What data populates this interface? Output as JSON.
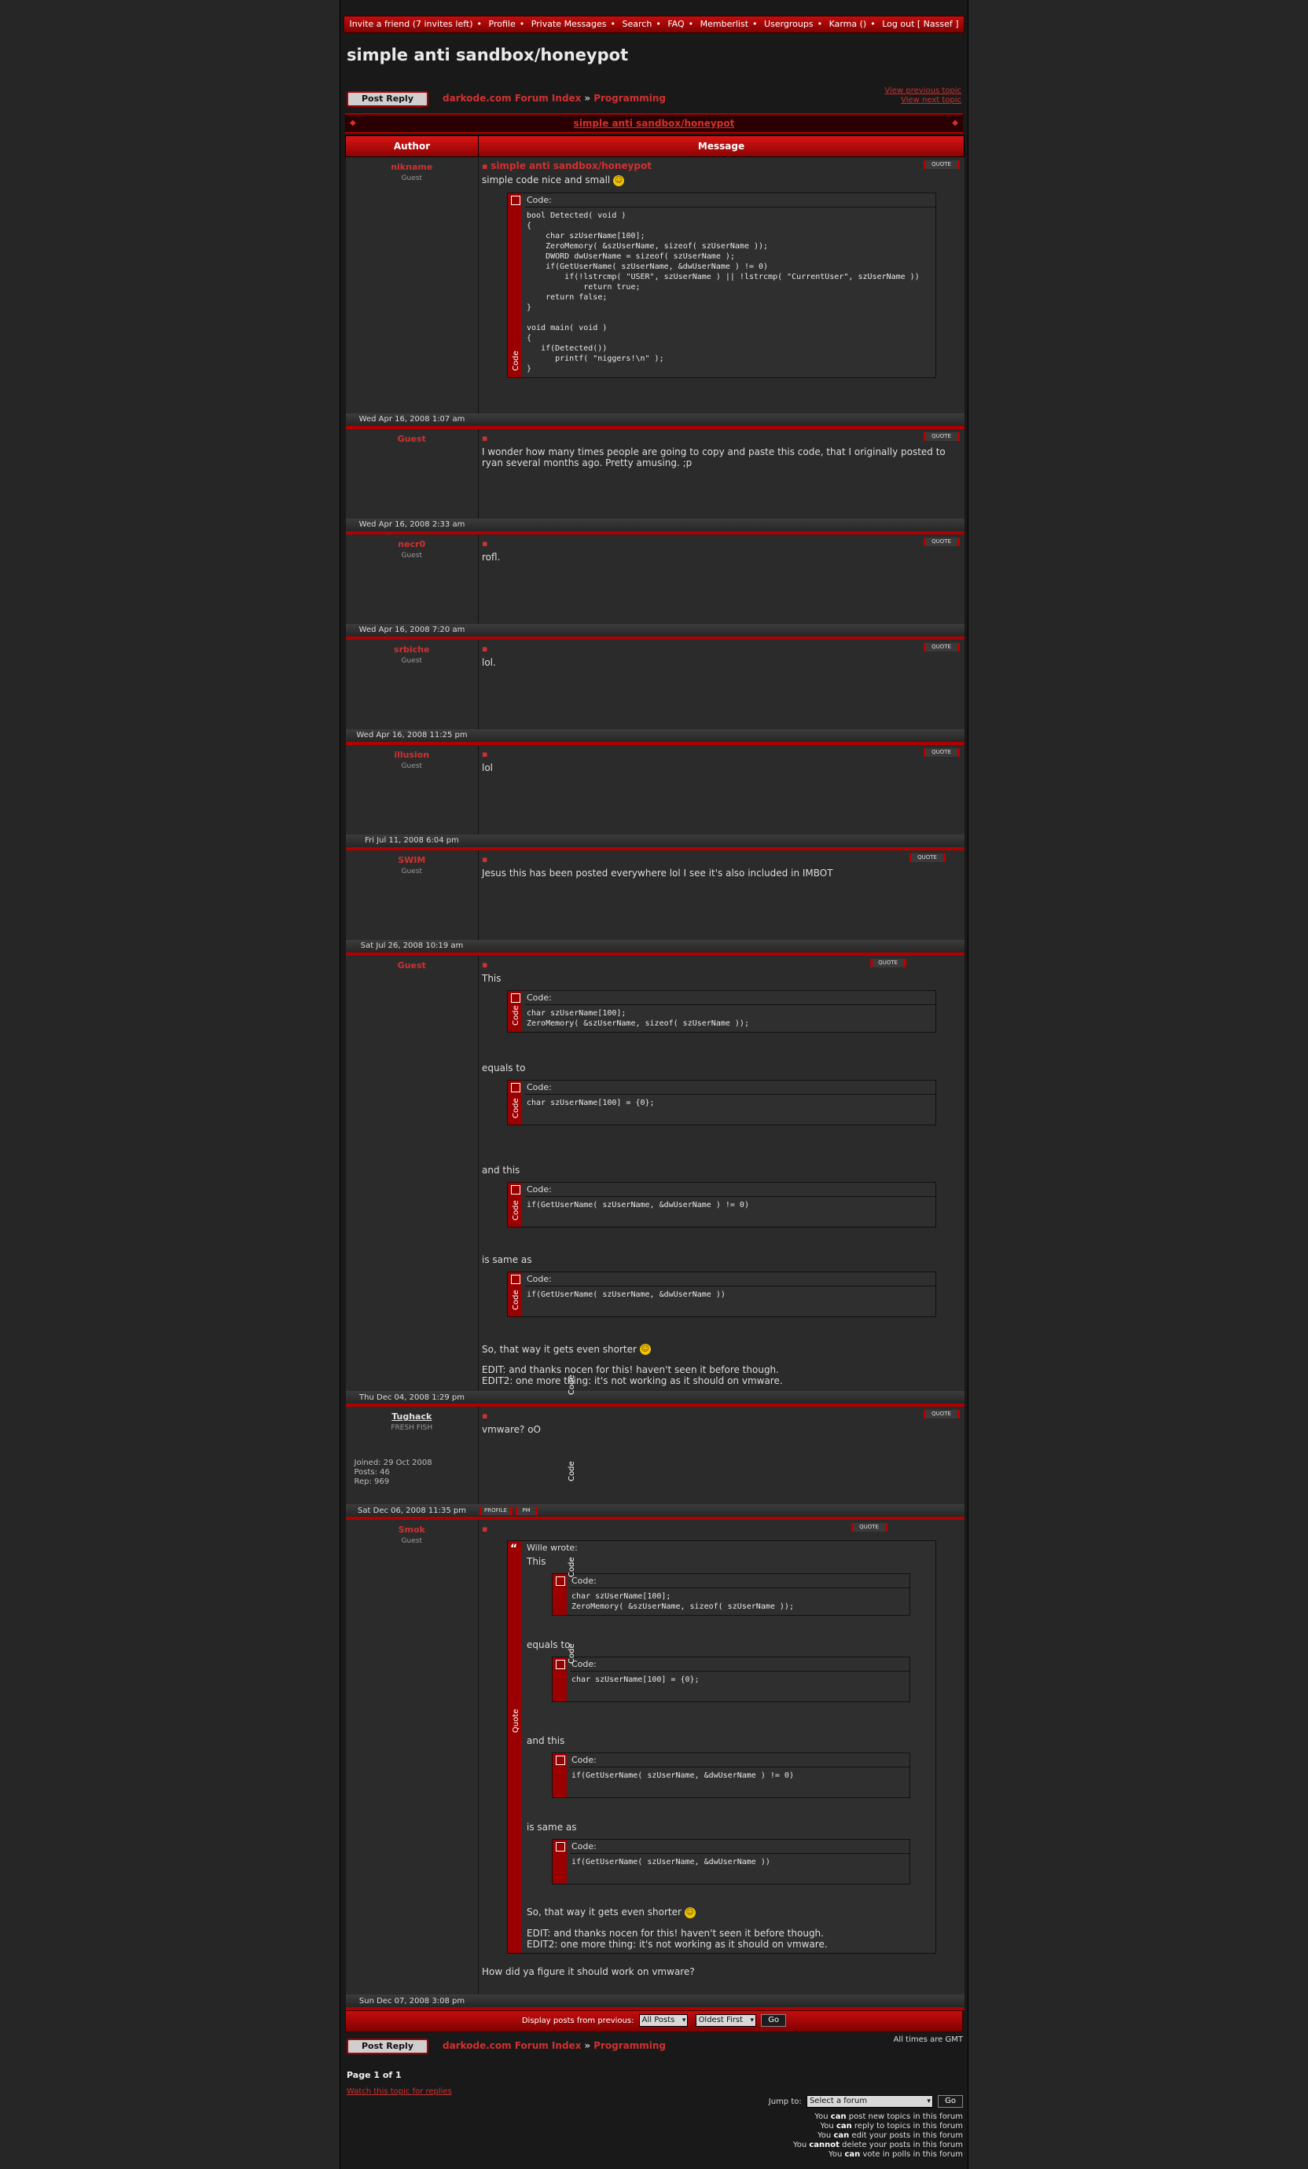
{
  "nav": {
    "items": [
      "Invite a friend (7 invites left)",
      "Profile",
      "Private Messages",
      "Search",
      "FAQ",
      "Memberlist",
      "Usergroups",
      "Karma ()",
      "Log out [ Nassef ]"
    ],
    "separator": "•"
  },
  "page_title": "simple anti sandbox/honeypot",
  "actions": {
    "post_reply": "Post Reply",
    "forum_index": "darkode.com Forum Index",
    "crumb_sep": "»",
    "forum": "Programming",
    "prev_topic": "View previous topic",
    "next_topic": "View next topic"
  },
  "topic_link": "simple anti sandbox/honeypot",
  "table": {
    "author_header": "Author",
    "message_header": "Message"
  },
  "posts": [
    {
      "author": "nikname",
      "rank": "Guest",
      "date": "Wed Apr 16, 2008 1:07 am",
      "title": "simple anti sandbox/honeypot",
      "text_before": "simple code nice and small",
      "smiley_after_text": true,
      "code": "bool Detected( void )\n{\n    char szUserName[100];\n    ZeroMemory( &szUserName, sizeof( szUserName ));\n    DWORD dwUserName = sizeof( szUserName );\n    if(GetUserName( szUserName, &dwUserName ) != 0)\n        if(!lstrcmp( \"USER\", szUserName ) || !lstrcmp( \"CurrentUser\", szUserName ))\n            return true;\n    return false;\n}\n\nvoid main( void )\n{\n   if(Detected())\n      printf( \"niggers!\\n\" );\n}"
    },
    {
      "author": "Guest",
      "rank": "",
      "date": "Wed Apr 16, 2008 2:33 am",
      "text": "I wonder how many times people are going to copy and paste this code, that I originally posted to ryan several months ago. Pretty amusing. ;p"
    },
    {
      "author": "necr0",
      "rank": "Guest",
      "date": "Wed Apr 16, 2008 7:20 am",
      "text": "rofl."
    },
    {
      "author": "srbiche",
      "rank": "Guest",
      "date": "Wed Apr 16, 2008 11:25 pm",
      "text": "lol."
    },
    {
      "author": "illusion",
      "rank": "Guest",
      "date": "Fri Jul 11, 2008 6:04 pm",
      "text": "lol"
    },
    {
      "author": "SWIM",
      "rank": "Guest",
      "date": "Sat Jul 26, 2008 10:19 am",
      "text": "Jesus this has been posted everywhere lol I see it's also included in IMBOT"
    },
    {
      "author": "Guest",
      "rank": "",
      "date": "Thu Dec 04, 2008 1:29 pm",
      "t1": "This",
      "c1": "char szUserName[100];\nZeroMemory( &szUserName, sizeof( szUserName ));",
      "t2": "equals to",
      "c2": "char szUserName[100] = {0};",
      "t3": "and this",
      "c3": "if(GetUserName( szUserName, &dwUserName ) != 0)",
      "t4": "is same as",
      "c4": "if(GetUserName( szUserName, &dwUserName ))",
      "t5": "So, that way it gets even shorter",
      "t6": "EDIT: and thanks nocen for this! haven't seen it before though.\nEDIT2: one more thing: it's not working as it should on vmware."
    },
    {
      "author": "Tughack",
      "rank": "FRESH FISH",
      "date": "Sat Dec 06, 2008 11:35 pm",
      "stats": [
        "Joined: 29 Oct 2008",
        "Posts: 46",
        "Rep: 969"
      ],
      "text": "vmware? oO",
      "btn_profile": "PROFILE",
      "btn_pm": "PM"
    },
    {
      "author": "Smok",
      "rank": "Guest",
      "date": "Sun Dec 07, 2008 3:08 pm",
      "quote_header": "Wille wrote:",
      "after": "How did ya figure it should work on vmware?"
    }
  ],
  "code_label": "Code:",
  "code_side": "Code",
  "quote_side": "Quote",
  "quote_btn": "QUOTE",
  "display_bar": {
    "label": "Display posts from previous:",
    "opt1": "All Posts",
    "opt2": "Oldest First",
    "go": "Go"
  },
  "bottom": {
    "times": "All times are GMT",
    "page": "Page 1 of 1",
    "watch": "Watch this topic for replies",
    "jump_label": "Jump to:",
    "jump_select": "Select a forum",
    "jump_go": "Go",
    "perms": [
      [
        "You ",
        "can",
        " post new topics in this forum"
      ],
      [
        "You ",
        "can",
        " reply to topics in this forum"
      ],
      [
        "You ",
        "can",
        " edit your posts in this forum"
      ],
      [
        "You ",
        "cannot",
        " delete your posts in this forum"
      ],
      [
        "You ",
        "can",
        " vote in polls in this forum"
      ]
    ]
  }
}
